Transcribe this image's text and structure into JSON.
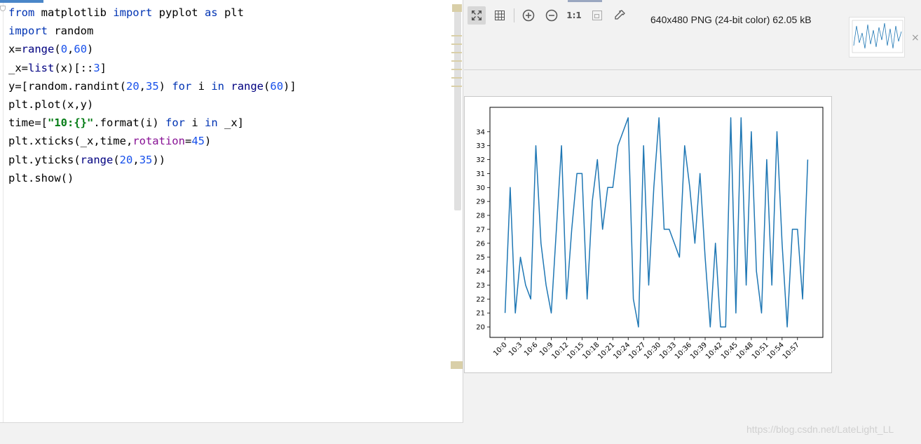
{
  "editor": {
    "code_lines": [
      [
        {
          "t": "from",
          "c": "kw"
        },
        {
          "t": " matplotlib ",
          "c": ""
        },
        {
          "t": "import",
          "c": "kw"
        },
        {
          "t": " pyplot ",
          "c": ""
        },
        {
          "t": "as",
          "c": "kw"
        },
        {
          "t": " plt",
          "c": ""
        }
      ],
      [
        {
          "t": "import",
          "c": "kw"
        },
        {
          "t": " random",
          "c": ""
        }
      ],
      [
        {
          "t": "x=",
          "c": ""
        },
        {
          "t": "range",
          "c": "fn"
        },
        {
          "t": "(",
          "c": ""
        },
        {
          "t": "0",
          "c": "num"
        },
        {
          "t": ",",
          "c": ""
        },
        {
          "t": "60",
          "c": "num"
        },
        {
          "t": ")",
          "c": ""
        }
      ],
      [
        {
          "t": "_x=",
          "c": ""
        },
        {
          "t": "list",
          "c": "fn"
        },
        {
          "t": "(x)[::",
          "c": ""
        },
        {
          "t": "3",
          "c": "num"
        },
        {
          "t": "]",
          "c": ""
        }
      ],
      [
        {
          "t": "y=[random.randint(",
          "c": ""
        },
        {
          "t": "20",
          "c": "num"
        },
        {
          "t": ",",
          "c": ""
        },
        {
          "t": "35",
          "c": "num"
        },
        {
          "t": ") ",
          "c": ""
        },
        {
          "t": "for",
          "c": "kw"
        },
        {
          "t": " i ",
          "c": ""
        },
        {
          "t": "in",
          "c": "kw"
        },
        {
          "t": " ",
          "c": ""
        },
        {
          "t": "range",
          "c": "fn"
        },
        {
          "t": "(",
          "c": ""
        },
        {
          "t": "60",
          "c": "num"
        },
        {
          "t": ")]",
          "c": ""
        }
      ],
      [
        {
          "t": "plt.plot(x,y)",
          "c": ""
        }
      ],
      [
        {
          "t": "time=[",
          "c": ""
        },
        {
          "t": "\"10:{}\"",
          "c": "str"
        },
        {
          "t": ".format(i) ",
          "c": ""
        },
        {
          "t": "for",
          "c": "kw"
        },
        {
          "t": " i ",
          "c": ""
        },
        {
          "t": "in",
          "c": "kw"
        },
        {
          "t": " _x]",
          "c": ""
        }
      ],
      [
        {
          "t": "plt.xticks(_x,time,",
          "c": ""
        },
        {
          "t": "rotation",
          "c": "param"
        },
        {
          "t": "=",
          "c": ""
        },
        {
          "t": "45",
          "c": "num"
        },
        {
          "t": ")",
          "c": ""
        }
      ],
      [
        {
          "t": "plt.yticks(",
          "c": ""
        },
        {
          "t": "range",
          "c": "fn"
        },
        {
          "t": "(",
          "c": ""
        },
        {
          "t": "20",
          "c": "num"
        },
        {
          "t": ",",
          "c": ""
        },
        {
          "t": "35",
          "c": "num"
        },
        {
          "t": "))",
          "c": ""
        }
      ],
      [
        {
          "t": "plt.show()",
          "c": ""
        }
      ]
    ]
  },
  "viewer": {
    "toolbar": {
      "fit_icon": "fit-to-window-icon",
      "grid_icon": "grid-icon",
      "zoom_in_icon": "zoom-in-icon",
      "zoom_out_icon": "zoom-out-icon",
      "actual_size_label": "1:1",
      "fit_image_icon": "fit-image-icon",
      "color_picker_icon": "eyedropper-icon"
    },
    "image_info": "640x480 PNG (24-bit color) 62.05 kB",
    "thumb_close": "×"
  },
  "watermark": "https://blog.csdn.net/LateLight_LL",
  "chart_data": {
    "type": "line",
    "title": "",
    "xlabel": "",
    "ylabel": "",
    "x": [
      0,
      1,
      2,
      3,
      4,
      5,
      6,
      7,
      8,
      9,
      10,
      11,
      12,
      13,
      14,
      15,
      16,
      17,
      18,
      19,
      20,
      21,
      22,
      23,
      24,
      25,
      26,
      27,
      28,
      29,
      30,
      31,
      32,
      33,
      34,
      35,
      36,
      37,
      38,
      39,
      40,
      41,
      42,
      43,
      44,
      45,
      46,
      47,
      48,
      49,
      50,
      51,
      52,
      53,
      54,
      55,
      56,
      57,
      58,
      59
    ],
    "y": [
      21,
      30,
      21,
      25,
      23,
      22,
      33,
      26,
      23,
      21,
      27,
      33,
      22,
      27,
      31,
      31,
      22,
      29,
      32,
      27,
      30,
      30,
      33,
      34,
      35,
      22,
      20,
      33,
      23,
      30,
      35,
      27,
      27,
      26,
      25,
      33,
      30,
      26,
      31,
      25,
      20,
      26,
      20,
      20,
      35,
      21,
      35,
      23,
      34,
      24,
      21,
      32,
      23,
      34,
      26,
      20,
      27,
      27,
      22,
      32
    ],
    "xticks": [
      0,
      3,
      6,
      9,
      12,
      15,
      18,
      21,
      24,
      27,
      30,
      33,
      36,
      39,
      42,
      45,
      48,
      51,
      54,
      57
    ],
    "xtick_labels": [
      "10:0",
      "10:3",
      "10:6",
      "10:9",
      "10:12",
      "10:15",
      "10:18",
      "10:21",
      "10:24",
      "10:27",
      "10:30",
      "10:33",
      "10:36",
      "10:39",
      "10:42",
      "10:45",
      "10:48",
      "10:51",
      "10:54",
      "10:57"
    ],
    "yticks": [
      20,
      21,
      22,
      23,
      24,
      25,
      26,
      27,
      28,
      29,
      30,
      31,
      32,
      33,
      34
    ],
    "xlim": [
      -2.95,
      61.95
    ],
    "ylim": [
      19.25,
      35.75
    ],
    "xtick_rotation": 45,
    "grid": false,
    "line_color": "#1f77b4"
  }
}
